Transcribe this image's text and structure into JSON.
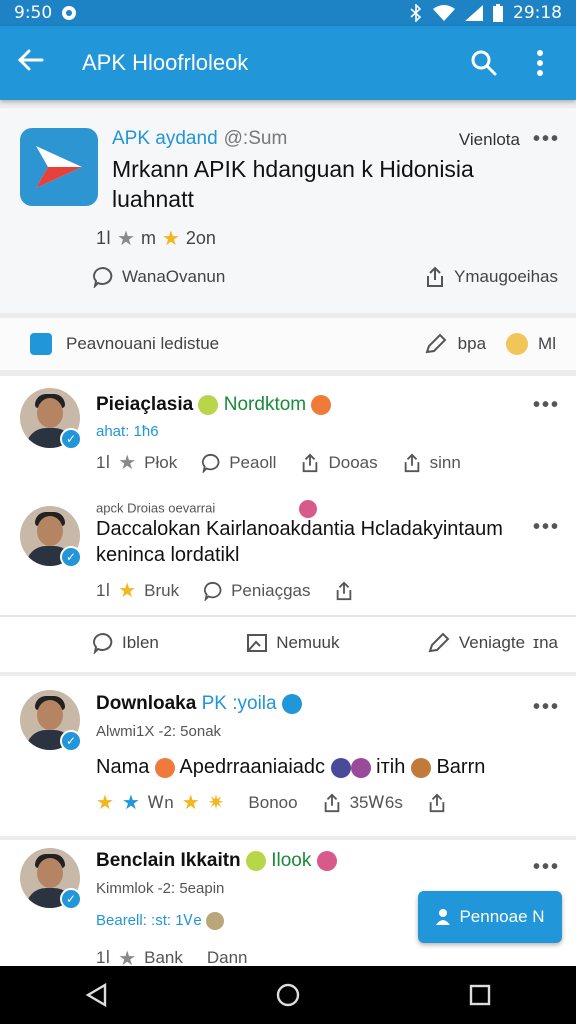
{
  "status": {
    "left_time": "9:50",
    "right_time": "29:18"
  },
  "appbar": {
    "title": "APK Hloofrloleok"
  },
  "featured": {
    "brand": "APK aydand",
    "handle": "@:Sum",
    "meta": "Vienlota",
    "title": "Mrkann APIK hdanguan k Hidonisia luahnatt",
    "rating_prefix": "1ⅼ",
    "rating_mid": "m",
    "rating_suffix": "2on",
    "comment_label": "WanaOvanun",
    "share_label": "Ymaugoeihas"
  },
  "promote": {
    "label": "Peavnouani ledistue",
    "edit_label": "bpa",
    "count_label": "Ml"
  },
  "posts": [
    {
      "name": "Pieiaçlasia",
      "accent": "Nordktom",
      "sub": "ahat: 1ħ6",
      "actions": [
        "Płok",
        "Peaoll",
        "Dooas",
        "sinn"
      ]
    },
    {
      "small_header": "apck Droias oevarrai",
      "text": "Daccalokan Kairlanoakdantia Hcladakyintaum kenincа lordatikl",
      "actions": [
        "Bruk",
        "Peniaçgas"
      ]
    },
    {
      "footer_actions": [
        "Iblen",
        "Nemuuk",
        "Veniagte"
      ],
      "footer_right": "ɪna"
    },
    {
      "name": "Downloaka",
      "name_blue": "PK :yoila",
      "sub": "Alwmi1X -2: 5onak",
      "text_a": "Nama",
      "text_b": "Apedrraaniaiadc",
      "text_c": "iтih",
      "text_d": "Barrn",
      "actions": [
        "Ꮃn",
        "Bonoo",
        "35Ꮃ6s"
      ]
    },
    {
      "name": "Benclain Ikkaitn",
      "accent": "Ilook",
      "sub": "Kimmlok -2: 5eapin",
      "sub2": "Bearell: :st: 1Ꮩe",
      "actions": [
        "Bank",
        "Dann"
      ]
    }
  ],
  "fab": {
    "label": "Pennoae N"
  },
  "colors": {
    "primary": "#2196d8",
    "status": "#1d83c4",
    "star": "#f3b61f"
  }
}
